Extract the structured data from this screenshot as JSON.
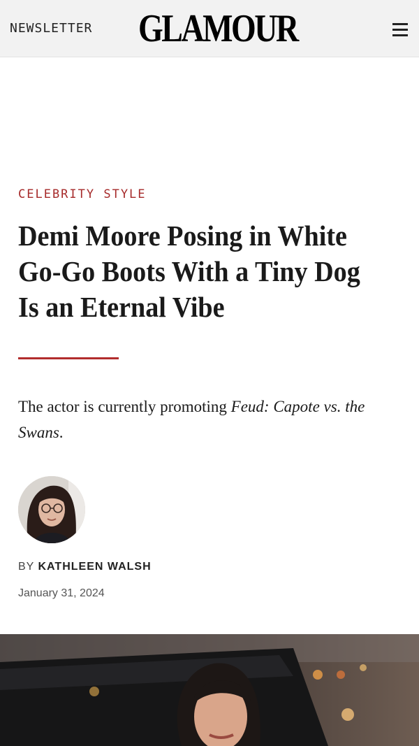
{
  "header": {
    "newsletter_label": "NEWSLETTER",
    "logo_text": "GLAMOUR",
    "menu_icon": "hamburger-menu-icon"
  },
  "article": {
    "section": "CELEBRITY STYLE",
    "title": "Demi Moore Posing in White Go-Go Boots With a Tiny Dog Is an Eternal Vibe",
    "dek_prefix": "The actor is currently promoting ",
    "dek_italic": "Feud: Capote vs. the Swans",
    "dek_suffix": ".",
    "byline_prefix": "BY ",
    "author": "KATHLEEN WALSH",
    "date": "January 31, 2024"
  },
  "colors": {
    "accent": "#b22d2d",
    "header_bg": "#f2f2f2"
  }
}
